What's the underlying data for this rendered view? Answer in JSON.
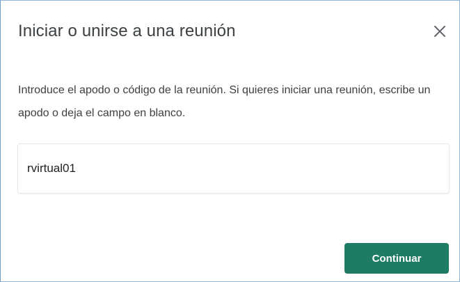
{
  "dialog": {
    "title": "Iniciar o unirse a una reunión",
    "description": "Introduce el apodo o código de la reunión. Si quieres iniciar una reunión, escribe un apodo o deja el campo en blanco.",
    "input": {
      "value": "rvirtual01"
    },
    "continue_label": "Continuar",
    "close_icon": "close-icon",
    "accent_color": "#1e7c64"
  }
}
